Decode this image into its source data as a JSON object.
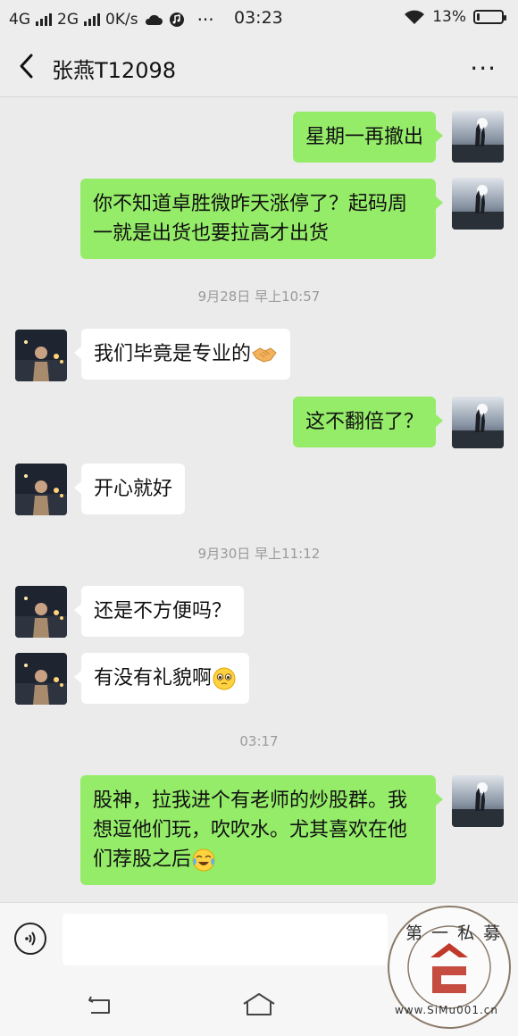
{
  "status_bar": {
    "network_1": "4G",
    "network_2": "2G",
    "speed": "0K/s",
    "dots": "···",
    "time": "03:23",
    "battery": "13%",
    "battery_level": 0.13
  },
  "header": {
    "title": "张燕T12098",
    "more": "···"
  },
  "messages": [
    {
      "side": "me",
      "text": "星期一再撤出"
    },
    {
      "side": "me",
      "text": "你不知道卓胜微昨天涨停了？起码周一就是出货也要拉高才出货"
    },
    {
      "timestamp": "9月28日 早上10:57"
    },
    {
      "side": "other",
      "text": "我们毕竟是专业的",
      "emoji": "handshake"
    },
    {
      "side": "me",
      "text": "这不翻倍了？"
    },
    {
      "side": "other",
      "text": "开心就好"
    },
    {
      "timestamp": "9月30日 早上11:12"
    },
    {
      "side": "other",
      "text": "还是不方便吗？"
    },
    {
      "side": "other",
      "text": "有没有礼貌啊",
      "emoji": "pleading-face"
    },
    {
      "timestamp": "03:17"
    },
    {
      "side": "me",
      "text": "股神，拉我进个有老师的炒股群。我想逗他们玩，吹吹水。尤其喜欢在他们荐股之后",
      "emoji": "crying-laughing"
    }
  ],
  "input": {
    "placeholder": ""
  },
  "watermark": {
    "text_top": "第 一 私 募",
    "text_url": "www.SiMu001.cn",
    "accent": "#c0392b"
  },
  "colors": {
    "my_bubble": "#95ec69",
    "other_bubble": "#ffffff",
    "background": "#ebebeb"
  }
}
